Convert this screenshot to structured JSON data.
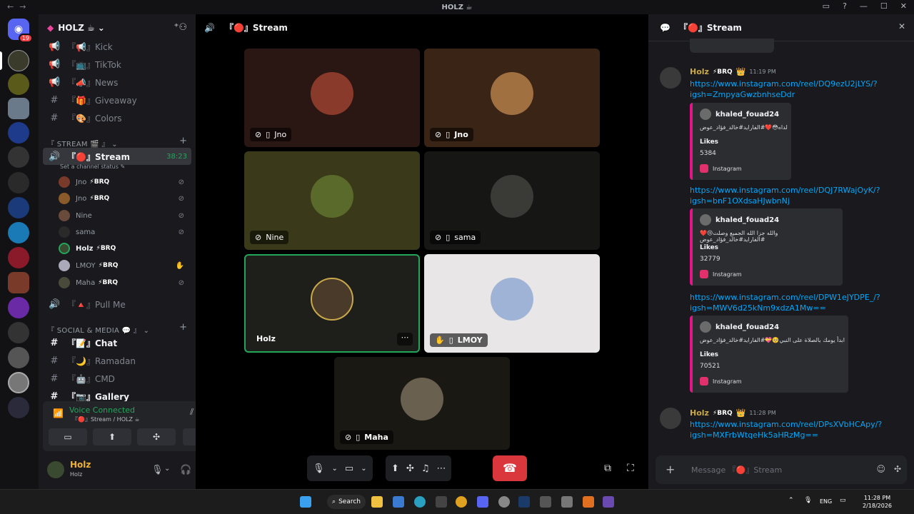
{
  "window": {
    "title": "HOLZ ☕"
  },
  "guild": {
    "name": "HOLZ ☕"
  },
  "channels_top": [
    {
      "label": "『📢』Kick"
    },
    {
      "label": "『📺』TikTok"
    },
    {
      "label": "『📣』News"
    },
    {
      "label": "『🎁』Giveaway"
    },
    {
      "label": "『🎨』Colors"
    }
  ],
  "category_stream": "『 STREAM 🎬 』",
  "stream_channel": {
    "label": "『🔴』Stream",
    "time": "38:23",
    "status": "Set a channel status"
  },
  "voice_users": [
    {
      "name": "Jno",
      "tag": "⚡BRQ"
    },
    {
      "name": "Jno",
      "tag": "⚡BRQ"
    },
    {
      "name": "Nine",
      "tag": ""
    },
    {
      "name": "sama",
      "tag": ""
    },
    {
      "name": "Holz",
      "tag": "⚡BRQ"
    },
    {
      "name": "LMOY",
      "tag": "⚡BRQ"
    },
    {
      "name": "Maha",
      "tag": "⚡BRQ"
    }
  ],
  "pull_channel": {
    "label": "『🔺』Pull Me"
  },
  "category_social": "『 SOCIAL & MEDIA 💬 』",
  "channels_social": [
    {
      "label": "『📝』Chat"
    },
    {
      "label": "『🌙』Ramadan"
    },
    {
      "label": "『🤖』CMD"
    },
    {
      "label": "『📷』Gallery"
    }
  ],
  "voice_status": {
    "title": "Voice Connected",
    "sub": "『🔴』Stream / HOLZ ☕"
  },
  "user": {
    "name": "Holz",
    "sub": "Holz"
  },
  "stage": {
    "title": "『🔴』Stream"
  },
  "tiles": [
    {
      "name": "Jno"
    },
    {
      "name": "Jno"
    },
    {
      "name": "Nine"
    },
    {
      "name": "sama"
    },
    {
      "name": "Holz"
    },
    {
      "name": "LMOY"
    },
    {
      "name": "Maha"
    }
  ],
  "chat": {
    "title": "『🔴』Stream",
    "placeholder": "Message 『🔴』Stream",
    "messages": [
      {
        "author": "Holz",
        "tag": "⚡BRQ",
        "crown": "👑",
        "time": "11:19 PM",
        "link": "https://www.instagram.com/reel/DQ9ezU2jLYS/?igsh=ZmpyaGwzbnhseDdr",
        "embed": {
          "author": "khaled_fouad24",
          "text": "لداه😳❤️#الفارايد#خالد_فؤاد_عوض",
          "likes_label": "Likes",
          "likes": "5384",
          "provider": "Instagram"
        }
      },
      {
        "link": "https://www.instagram.com/reel/DQJ7RWajOyK/?igsh=bnF1OXdsaHJwbnNj",
        "embed": {
          "author": "khaled_fouad24",
          "text": "والله جزا الله الجميع وصلت😢❤️#الفارايد#خالد_فؤاد_عوض",
          "likes_label": "Likes",
          "likes": "32779",
          "provider": "Instagram"
        }
      },
      {
        "link": "https://www.instagram.com/reel/DPW1eJYDPE_/?igsh=MWV6d25kNm9xdzA1Mw==",
        "embed": {
          "author": "khaled_fouad24",
          "text": "ابدأ يومك بالصلاة على النبي🥺💝#الفارايد#خالد_فؤاد_عوض",
          "likes_label": "Likes",
          "likes": "70521",
          "provider": "Instagram"
        }
      },
      {
        "author": "Holz",
        "tag": "⚡BRQ",
        "crown": "👑",
        "time": "11:28 PM",
        "link": "https://www.instagram.com/reel/DPsXVbHCApy/?igsh=MXFrbWtqeHk5aHRzMg=="
      }
    ]
  },
  "taskbar": {
    "search": "Search",
    "lang": "ENG",
    "time": "11:28 PM",
    "date": "2/18/2026"
  },
  "server_badge": "19"
}
